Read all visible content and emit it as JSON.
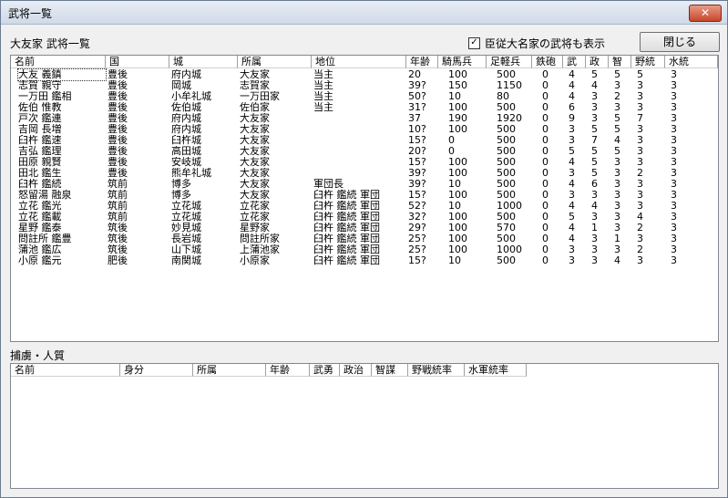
{
  "window": {
    "title": "武将一覧",
    "close_glyph": "✕"
  },
  "header": {
    "label": "大友家 武将一覧",
    "checkbox_label": "臣従大名家の武将も表示",
    "checkbox_checked": "✓",
    "close_button": "閉じる"
  },
  "table": {
    "columns": [
      "名前",
      "国",
      "城",
      "所属",
      "地位",
      "年齢",
      "騎馬兵",
      "足軽兵",
      "鉄砲",
      "武",
      "政",
      "智",
      "野統",
      "水統"
    ],
    "rows": [
      [
        "大友 義鎮",
        "豊後",
        "府内城",
        "大友家",
        "当主",
        "20",
        "100",
        "500",
        "0",
        "4",
        "5",
        "5",
        "5",
        "3"
      ],
      [
        "志賀 親守",
        "豊後",
        "岡城",
        "志賀家",
        "当主",
        "39?",
        "150",
        "1150",
        "0",
        "4",
        "4",
        "3",
        "3",
        "3"
      ],
      [
        "一万田 鑑相",
        "豊後",
        "小牟礼城",
        "一万田家",
        "当主",
        "50?",
        "10",
        "80",
        "0",
        "4",
        "3",
        "2",
        "3",
        "3"
      ],
      [
        "佐伯 惟教",
        "豊後",
        "佐伯城",
        "佐伯家",
        "当主",
        "31?",
        "100",
        "500",
        "0",
        "6",
        "3",
        "3",
        "3",
        "3"
      ],
      [
        "戸次 鑑連",
        "豊後",
        "府内城",
        "大友家",
        "",
        "37",
        "190",
        "1920",
        "0",
        "9",
        "3",
        "5",
        "7",
        "3"
      ],
      [
        "吉岡 長増",
        "豊後",
        "府内城",
        "大友家",
        "",
        "10?",
        "100",
        "500",
        "0",
        "3",
        "5",
        "5",
        "3",
        "3"
      ],
      [
        "臼杵 鑑速",
        "豊後",
        "臼杵城",
        "大友家",
        "",
        "15?",
        "0",
        "500",
        "0",
        "3",
        "7",
        "4",
        "3",
        "3"
      ],
      [
        "吉弘 鑑理",
        "豊後",
        "高田城",
        "大友家",
        "",
        "20?",
        "0",
        "500",
        "0",
        "5",
        "5",
        "5",
        "3",
        "3"
      ],
      [
        "田原 親賢",
        "豊後",
        "安岐城",
        "大友家",
        "",
        "15?",
        "100",
        "500",
        "0",
        "4",
        "5",
        "3",
        "3",
        "3"
      ],
      [
        "田北 鑑生",
        "豊後",
        "熊牟礼城",
        "大友家",
        "",
        "39?",
        "100",
        "500",
        "0",
        "3",
        "5",
        "3",
        "2",
        "3"
      ],
      [
        "臼杵 鑑続",
        "筑前",
        "博多",
        "大友家",
        "軍団長",
        "39?",
        "10",
        "500",
        "0",
        "4",
        "6",
        "3",
        "3",
        "3"
      ],
      [
        "怒留湯 融泉",
        "筑前",
        "博多",
        "大友家",
        "臼杵 鑑続 軍団",
        "15?",
        "100",
        "500",
        "0",
        "3",
        "3",
        "3",
        "3",
        "3"
      ],
      [
        "立花 鑑光",
        "筑前",
        "立花城",
        "立花家",
        "臼杵 鑑続 軍団",
        "52?",
        "10",
        "1000",
        "0",
        "4",
        "4",
        "3",
        "3",
        "3"
      ],
      [
        "立花 鑑載",
        "筑前",
        "立花城",
        "立花家",
        "臼杵 鑑続 軍団",
        "32?",
        "100",
        "500",
        "0",
        "5",
        "3",
        "3",
        "4",
        "3"
      ],
      [
        "星野 鑑泰",
        "筑後",
        "妙見城",
        "星野家",
        "臼杵 鑑続 軍団",
        "29?",
        "100",
        "570",
        "0",
        "4",
        "1",
        "3",
        "2",
        "3"
      ],
      [
        "問註所 鑑豊",
        "筑後",
        "長岩城",
        "問註所家",
        "臼杵 鑑続 軍団",
        "25?",
        "100",
        "500",
        "0",
        "4",
        "3",
        "1",
        "3",
        "3"
      ],
      [
        "蒲池 鑑広",
        "筑後",
        "山下城",
        "上蒲池家",
        "臼杵 鑑続 軍団",
        "25?",
        "100",
        "1000",
        "0",
        "3",
        "3",
        "3",
        "2",
        "3"
      ],
      [
        "小原 鑑元",
        "肥後",
        "南関城",
        "小原家",
        "臼杵 鑑続 軍団",
        "15?",
        "10",
        "500",
        "0",
        "3",
        "3",
        "4",
        "3",
        "3"
      ]
    ]
  },
  "captives": {
    "label": "捕虜・人質",
    "columns": [
      "名前",
      "身分",
      "所属",
      "年齢",
      "武勇",
      "政治",
      "智謀",
      "野戦統率",
      "水軍統率"
    ]
  }
}
